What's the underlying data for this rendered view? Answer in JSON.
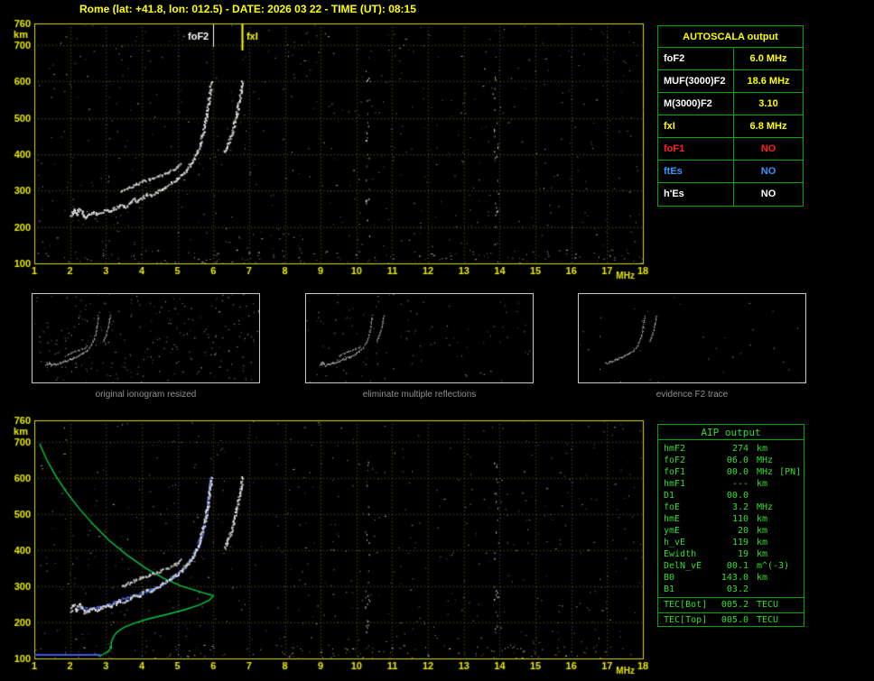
{
  "title": "Rome (lat: +41.8, lon: 012.5) - DATE: 2026 03 22 - TIME (UT): 08:15",
  "colors": {
    "accent_yellow": "#ffff00",
    "frame_yellow": "#d9d900",
    "table_green": "#00aa00",
    "aip_text_green": "#33dd33",
    "profile_green": "#00cc44",
    "fit_blue": "#4455ee",
    "alert_red": "#ff2020",
    "info_blue": "#3399ff",
    "trace_white": "#f5f5f5",
    "caption_gray": "#8f8f8f"
  },
  "ionogram": {
    "x_ticks": [
      1,
      2,
      3,
      4,
      5,
      6,
      7,
      8,
      9,
      10,
      11,
      12,
      13,
      14,
      15,
      16,
      17,
      18
    ],
    "x_unit": "MHz",
    "y_ticks": [
      760,
      700,
      600,
      500,
      400,
      300,
      200,
      100
    ],
    "y_unit": "km",
    "annotations": {
      "foF2_label": "foF2",
      "fxI_label": "fxI"
    }
  },
  "autoscala": {
    "header": "AUTOSCALA output",
    "rows": [
      {
        "label": "foF2",
        "value": "6.0 MHz",
        "color": "#ffffff",
        "value_color": "#ffff00"
      },
      {
        "label": "MUF(3000)F2",
        "value": "18.6 MHz",
        "color": "#ffffff",
        "value_color": "#ffff00"
      },
      {
        "label": "M(3000)F2",
        "value": "3.10",
        "color": "#ffffff",
        "value_color": "#ffff00"
      },
      {
        "label": "fxI",
        "value": "6.8 MHz",
        "color": "#ffff00",
        "value_color": "#ffff00"
      },
      {
        "label": "foF1",
        "value": "NO",
        "color": "#ff2020",
        "value_color": "#ff2020"
      },
      {
        "label": "ftEs",
        "value": "NO",
        "color": "#3399ff",
        "value_color": "#3399ff"
      },
      {
        "label": "h'Es",
        "value": "NO",
        "color": "#ffffff",
        "value_color": "#ffffff"
      }
    ]
  },
  "thumbnails": {
    "captions": [
      "original ionogram resized",
      "eliminate multiple reflections",
      "evidence F2 trace"
    ]
  },
  "aip": {
    "header": "AIP output",
    "rows": [
      {
        "label": "hmF2",
        "value": "274",
        "unit": "km"
      },
      {
        "label": "foF2",
        "value": "06.0",
        "unit": "MHz"
      },
      {
        "label": "foF1",
        "value": "00.0",
        "unit": "MHz",
        "extra": "[PN]"
      },
      {
        "label": "hmF1",
        "value": "---",
        "unit": "km"
      },
      {
        "label": "D1",
        "value": "00.0",
        "unit": ""
      },
      {
        "label": "foE",
        "value": "3.2",
        "unit": "MHz"
      },
      {
        "label": "hmE",
        "value": "110",
        "unit": "km"
      },
      {
        "label": "ymE",
        "value": "20",
        "unit": "km"
      },
      {
        "label": "h_vE",
        "value": "119",
        "unit": "km"
      },
      {
        "label": "Ewidth",
        "value": "19",
        "unit": "km"
      },
      {
        "label": "DelN_vE",
        "value": "00.1",
        "unit": "m^(-3)"
      },
      {
        "label": "B0",
        "value": "143.0",
        "unit": "km"
      },
      {
        "label": "B1",
        "value": "03.2",
        "unit": ""
      }
    ],
    "tec_rows": [
      {
        "label": "TEC[Bot]",
        "value": "005.2",
        "unit": "TECU"
      },
      {
        "label": "TEC[Top]",
        "value": "005.0",
        "unit": "TECU"
      }
    ]
  },
  "chart_data": {
    "type": "scatter",
    "xlabel": "MHz",
    "ylabel": "km",
    "x_range": [
      1,
      18
    ],
    "y_range": [
      100,
      760
    ],
    "foF2_MHz": 6.0,
    "fxI_MHz": 6.8,
    "noise_streaks_MHz": [
      10.3,
      13.9
    ],
    "trace_o": [
      [
        2.0,
        232
      ],
      [
        2.08,
        248
      ],
      [
        2.16,
        236
      ],
      [
        2.24,
        252
      ],
      [
        2.32,
        240
      ],
      [
        2.4,
        228
      ],
      [
        2.52,
        235
      ],
      [
        2.64,
        242
      ],
      [
        2.76,
        236
      ],
      [
        2.88,
        243
      ],
      [
        3.0,
        250
      ],
      [
        3.12,
        245
      ],
      [
        3.24,
        253
      ],
      [
        3.38,
        262
      ],
      [
        3.52,
        258
      ],
      [
        3.64,
        268
      ],
      [
        3.76,
        278
      ],
      [
        3.88,
        272
      ],
      [
        4.0,
        282
      ],
      [
        4.12,
        292
      ],
      [
        4.24,
        287
      ],
      [
        4.38,
        296
      ],
      [
        4.52,
        305
      ],
      [
        4.66,
        313
      ],
      [
        4.8,
        322
      ],
      [
        4.95,
        333
      ],
      [
        5.1,
        345
      ],
      [
        5.25,
        361
      ],
      [
        5.4,
        381
      ],
      [
        5.5,
        401
      ],
      [
        5.6,
        426
      ],
      [
        5.68,
        453
      ],
      [
        5.75,
        483
      ],
      [
        5.81,
        516
      ],
      [
        5.86,
        549
      ],
      [
        5.9,
        579
      ],
      [
        5.93,
        602
      ]
    ],
    "trace_secondary": [
      [
        3.42,
        300
      ],
      [
        3.62,
        310
      ],
      [
        3.82,
        319
      ],
      [
        4.02,
        327
      ],
      [
        4.22,
        334
      ],
      [
        4.46,
        342
      ],
      [
        4.7,
        352
      ],
      [
        4.92,
        362
      ],
      [
        5.06,
        374
      ]
    ],
    "trace_x": [
      [
        6.3,
        408
      ],
      [
        6.4,
        433
      ],
      [
        6.5,
        459
      ],
      [
        6.58,
        489
      ],
      [
        6.65,
        519
      ],
      [
        6.71,
        549
      ],
      [
        6.76,
        576
      ],
      [
        6.8,
        602
      ]
    ],
    "fitted_blue": [
      [
        2.2,
        240
      ],
      [
        2.6,
        239
      ],
      [
        3.0,
        249
      ],
      [
        3.4,
        263
      ],
      [
        3.8,
        277
      ],
      [
        4.2,
        291
      ],
      [
        4.6,
        309
      ],
      [
        5.0,
        337
      ],
      [
        5.3,
        367
      ],
      [
        5.5,
        399
      ],
      [
        5.65,
        441
      ],
      [
        5.77,
        491
      ],
      [
        5.85,
        541
      ],
      [
        5.9,
        586
      ],
      [
        5.93,
        606
      ]
    ],
    "blue_E_segment": [
      [
        1.0,
        110
      ],
      [
        2.85,
        110
      ]
    ],
    "profile_green": [
      [
        1.15,
        695
      ],
      [
        1.35,
        650
      ],
      [
        1.6,
        606
      ],
      [
        1.9,
        561
      ],
      [
        2.25,
        516
      ],
      [
        2.65,
        471
      ],
      [
        3.1,
        426
      ],
      [
        3.6,
        386
      ],
      [
        4.1,
        351
      ],
      [
        4.6,
        323
      ],
      [
        5.1,
        301
      ],
      [
        5.55,
        287
      ],
      [
        5.85,
        278
      ],
      [
        6.0,
        274
      ],
      [
        5.9,
        262
      ],
      [
        5.6,
        248
      ],
      [
        5.2,
        235
      ],
      [
        4.7,
        222
      ],
      [
        4.2,
        210
      ],
      [
        3.8,
        198
      ],
      [
        3.5,
        186
      ],
      [
        3.3,
        172
      ],
      [
        3.2,
        158
      ],
      [
        3.15,
        144
      ],
      [
        3.15,
        130
      ],
      [
        3.05,
        118
      ],
      [
        2.9,
        110
      ],
      [
        2.8,
        105
      ]
    ]
  }
}
